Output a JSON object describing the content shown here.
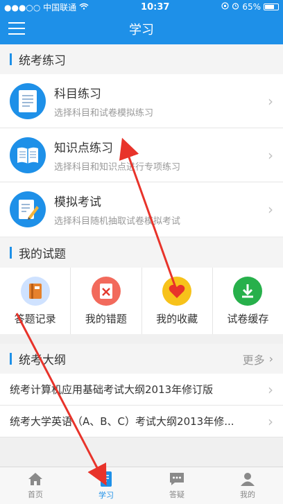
{
  "status": {
    "carrier": "●●●○○ 中国联通",
    "time": "10:37",
    "battery": "65%"
  },
  "navbar": {
    "title": "学习"
  },
  "sections": {
    "exam_practice": "统考练习",
    "my_questions": "我的试题",
    "outline": "统考大纲",
    "outline_more": "更多"
  },
  "practice_items": [
    {
      "title": "科目练习",
      "desc": "选择科目和试卷模拟练习"
    },
    {
      "title": "知识点练习",
      "desc": "选择科目和知识点进行专项练习"
    },
    {
      "title": "模拟考试",
      "desc": "选择科目随机抽取试卷模拟考试"
    }
  ],
  "question_tools": [
    {
      "label": "答题记录",
      "icon": "book-record-icon",
      "color": "#bcd7ff"
    },
    {
      "label": "我的错题",
      "icon": "wrong-answer-icon",
      "color": "#f26a5c"
    },
    {
      "label": "我的收藏",
      "icon": "heart-icon",
      "color": "#f7c21a"
    },
    {
      "label": "试卷缓存",
      "icon": "download-icon",
      "color": "#27b04b"
    }
  ],
  "outline_items": [
    "统考计算机应用基础考试大纲2013年修订版",
    "统考大学英语（A、B、C）考试大纲2013年修..."
  ],
  "tabs": [
    {
      "label": "首页",
      "icon": "home-icon"
    },
    {
      "label": "学习",
      "icon": "study-icon"
    },
    {
      "label": "答疑",
      "icon": "chat-icon"
    },
    {
      "label": "我的",
      "icon": "user-icon"
    }
  ],
  "colors": {
    "primary": "#1e90e8",
    "annotation": "#e8332a"
  }
}
